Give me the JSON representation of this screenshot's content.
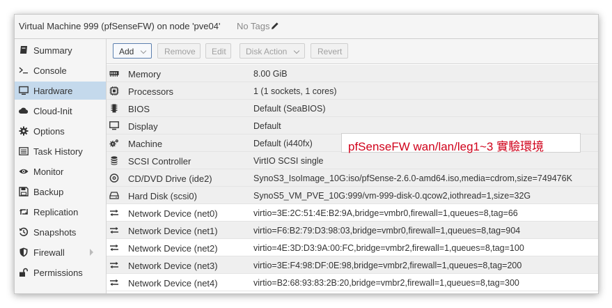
{
  "window": {
    "title": "Virtual Machine 999 (pfSenseFW) on node 'pve04'",
    "tags": "No Tags"
  },
  "sidebar": {
    "items": [
      {
        "label": "Summary",
        "icon": "book-icon"
      },
      {
        "label": "Console",
        "icon": "terminal-icon"
      },
      {
        "label": "Hardware",
        "icon": "monitor-icon",
        "selected": true
      },
      {
        "label": "Cloud-Init",
        "icon": "cloud-icon"
      },
      {
        "label": "Options",
        "icon": "gear-icon"
      },
      {
        "label": "Task History",
        "icon": "list-icon"
      },
      {
        "label": "Monitor",
        "icon": "eye-icon"
      },
      {
        "label": "Backup",
        "icon": "floppy-icon"
      },
      {
        "label": "Replication",
        "icon": "retweet-icon"
      },
      {
        "label": "Snapshots",
        "icon": "history-icon"
      },
      {
        "label": "Firewall",
        "icon": "shield-icon"
      },
      {
        "label": "Permissions",
        "icon": "unlock-icon"
      }
    ]
  },
  "toolbar": {
    "add": "Add",
    "remove": "Remove",
    "edit": "Edit",
    "disk_action": "Disk Action",
    "revert": "Revert"
  },
  "hardware": [
    {
      "name": "Memory",
      "value": "8.00 GiB",
      "icon": "memory-icon"
    },
    {
      "name": "Processors",
      "value": "1 (1 sockets, 1 cores)",
      "icon": "cpu-icon"
    },
    {
      "name": "BIOS",
      "value": "Default (SeaBIOS)",
      "icon": "microchip-icon"
    },
    {
      "name": "Display",
      "value": "Default",
      "icon": "desktop-icon"
    },
    {
      "name": "Machine",
      "value": "Default (i440fx)",
      "icon": "cogs-icon"
    },
    {
      "name": "SCSI Controller",
      "value": "VirtIO SCSI single",
      "icon": "database-icon"
    },
    {
      "name": "CD/DVD Drive (ide2)",
      "value": "SynoS3_IsoImage_10G:iso/pfSense-2.6.0-amd64.iso,media=cdrom,size=749476K",
      "icon": "cdrom-icon"
    },
    {
      "name": "Hard Disk (scsi0)",
      "value": "SynoS5_VM_PVE_10G:999/vm-999-disk-0.qcow2,iothread=1,size=32G",
      "icon": "hdd-icon"
    },
    {
      "name": "Network Device (net0)",
      "value": "virtio=3E:2C:51:4E:B2:9A,bridge=vmbr0,firewall=1,queues=8,tag=66",
      "icon": "exchange-icon"
    },
    {
      "name": "Network Device (net1)",
      "value": "virtio=F6:B2:79:D3:98:03,bridge=vmbr0,firewall=1,queues=8,tag=904",
      "icon": "exchange-icon"
    },
    {
      "name": "Network Device (net2)",
      "value": "virtio=4E:3D:D3:9A:00:FC,bridge=vmbr2,firewall=1,queues=8,tag=100",
      "icon": "exchange-icon"
    },
    {
      "name": "Network Device (net3)",
      "value": "virtio=3E:F4:98:DF:0E:98,bridge=vmbr2,firewall=1,queues=8,tag=200",
      "icon": "exchange-icon"
    },
    {
      "name": "Network Device (net4)",
      "value": "virtio=B2:68:93:83:2B:20,bridge=vmbr2,firewall=1,queues=8,tag=300",
      "icon": "exchange-icon"
    }
  ],
  "annotation": "pfSenseFW wan/lan/leg1~3 實驗環境",
  "colors": {
    "selected_bg": "#c4d9ec",
    "annotation_text": "#d0021b"
  }
}
